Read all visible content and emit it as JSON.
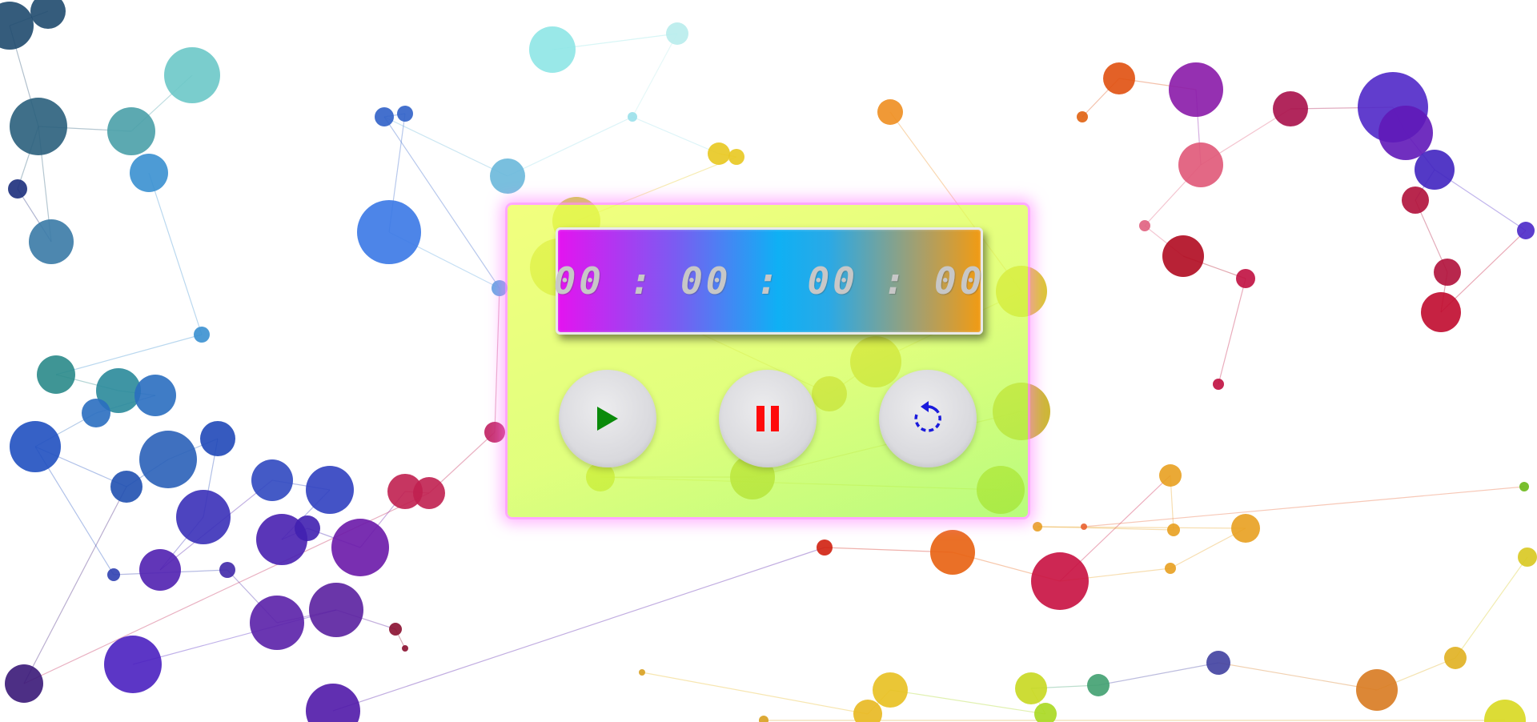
{
  "timer": {
    "display": "00 : 00 : 00 : 00"
  },
  "controls": {
    "play_icon": "play-icon",
    "pause_icon": "pause-icon",
    "reset_icon": "reset-icon"
  },
  "colors": {
    "panel": "#d4ff55",
    "panel_glow": "#ff8cff",
    "play": "#0a8a0a",
    "pause": "#ff0a0a",
    "reset": "#1a1adc",
    "digits": "#c7c7c7"
  }
}
